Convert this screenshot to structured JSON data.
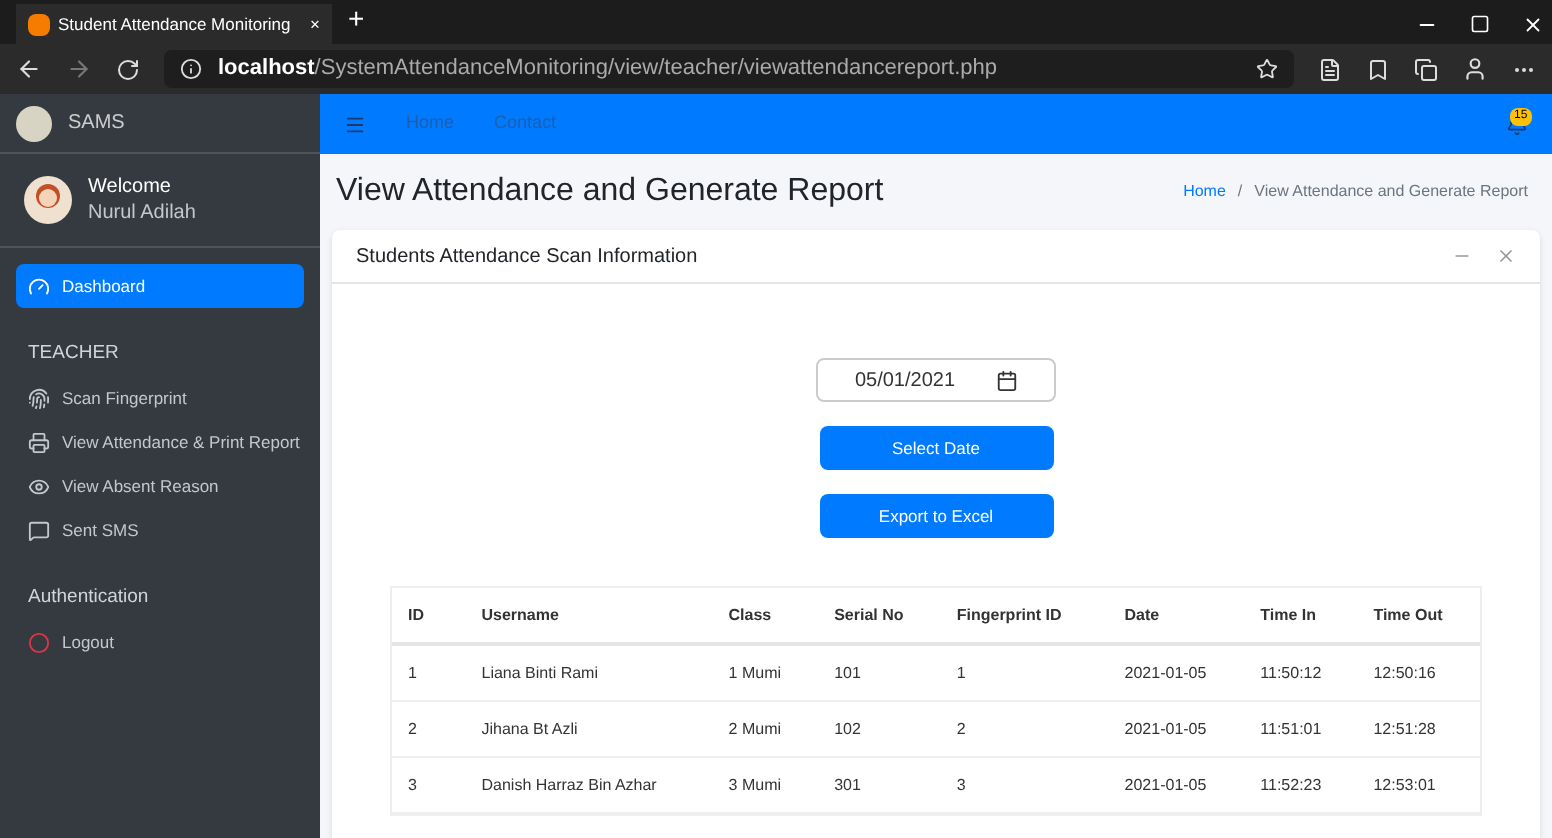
{
  "browser": {
    "tab_title": "Student Attendance Monitoring",
    "tab_close": "×",
    "new_tab": "+",
    "url_host": "localhost",
    "url_path": "/SystemAttendanceMonitoring/view/teacher/viewattendancereport.php"
  },
  "sidebar": {
    "brand": "SAMS",
    "welcome": "Welcome",
    "user": "Nurul Adilah",
    "items": [
      {
        "kind": "item",
        "label": "Dashboard",
        "selected": true
      },
      {
        "kind": "header",
        "label": "TEACHER"
      },
      {
        "kind": "item",
        "label": "Scan Fingerprint",
        "selected": false
      },
      {
        "kind": "item",
        "label": "View Attendance & Print Report",
        "selected": false
      },
      {
        "kind": "item",
        "label": "View Absent Reason",
        "selected": false
      },
      {
        "kind": "item",
        "label": "Sent SMS",
        "selected": false
      },
      {
        "kind": "header",
        "label": "Authentication"
      },
      {
        "kind": "item",
        "label": "Logout",
        "selected": false
      }
    ]
  },
  "navbar": {
    "links": [
      "Home",
      "Contact"
    ],
    "badge": "15"
  },
  "page": {
    "title": "View Attendance and Generate Report",
    "breadcrumb": [
      "Home",
      "View Attendance and Generate Report"
    ],
    "breadcrumb_sep": "/"
  },
  "card": {
    "title": "Students Attendance Scan Information",
    "date": "05/01/2021",
    "buttons": [
      "Select Date",
      "Export to Excel"
    ]
  },
  "table": {
    "columns": [
      "ID",
      "Username",
      "Class",
      "Serial No",
      "Fingerprint ID",
      "Date",
      "Time In",
      "Time Out"
    ],
    "rows": [
      [
        "1",
        "Liana Binti Rami",
        "1 Mumi",
        "101",
        "1",
        "2021-01-05",
        "11:50:12",
        "12:50:16"
      ],
      [
        "2",
        "Jihana Bt Azli",
        "2 Mumi",
        "102",
        "2",
        "2021-01-05",
        "11:51:01",
        "12:51:28"
      ],
      [
        "3",
        "Danish Harraz Bin Azhar",
        "3 Mumi",
        "301",
        "3",
        "2021-01-05",
        "11:52:23",
        "12:53:01"
      ]
    ]
  }
}
